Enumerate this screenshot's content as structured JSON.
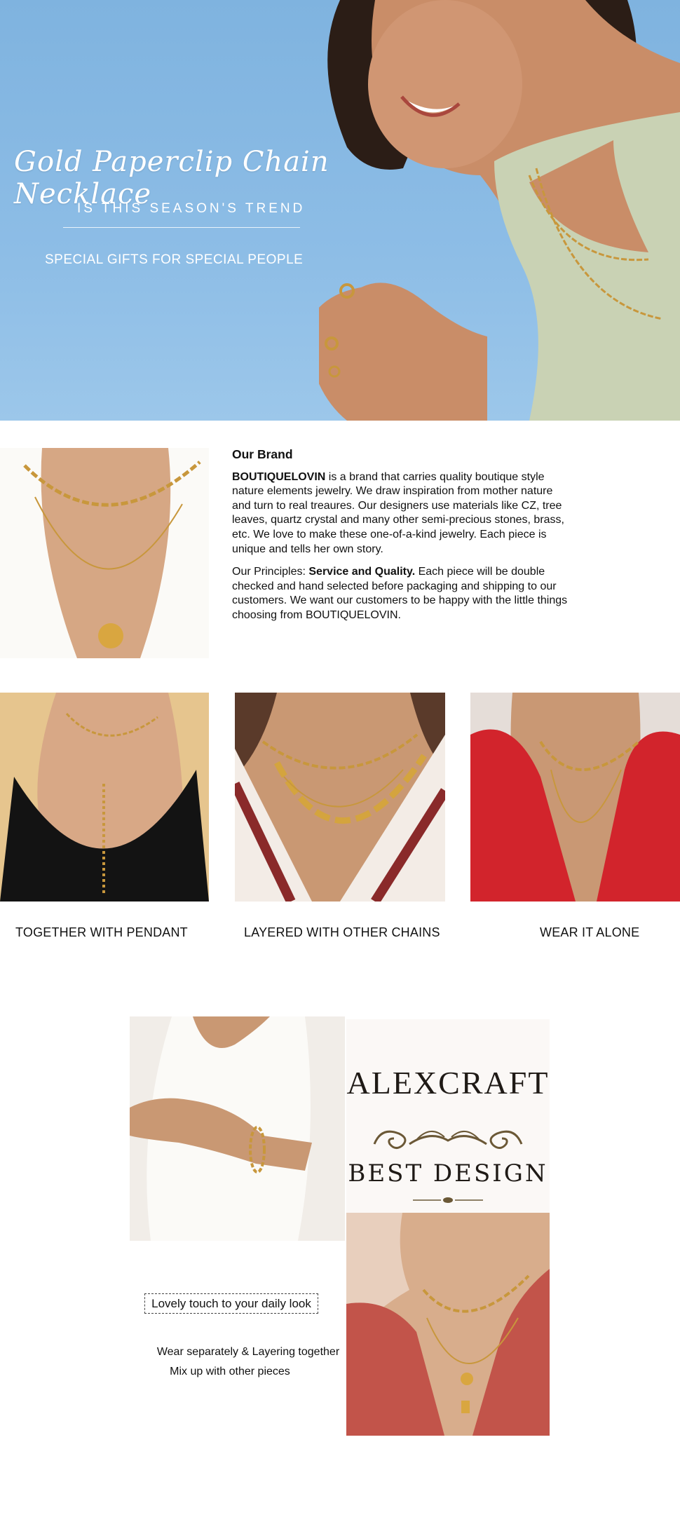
{
  "hero": {
    "title": "Gold Paperclip Chain Necklace",
    "subtitle": "IS THIS SEASON'S TREND",
    "tagline": "SPECIAL GIFTS FOR SPECIAL PEOPLE"
  },
  "brand": {
    "heading": "Our Brand",
    "brand_name": "BOUTIQUELOVIN",
    "paragraph1_rest": " is a brand that carries quality boutique style nature elements jewelry. We draw inspiration from mother nature and turn to real treaures. Our designers use materials like CZ, tree leaves, quartz crystal and many other semi-precious stones, brass, etc. We love to make these one-of-a-kind jewelry. Each piece is unique and tells her own story.",
    "principles_label": "Our Principles: ",
    "principles_bold": "Service and Quality.",
    "principles_rest": " Each piece will be double checked and hand selected before packaging and shipping to our customers. We want our customers to be happy with the little things choosing from BOUTIQUELOVIN."
  },
  "styles": {
    "captions": [
      "TOGETHER WITH PENDANT",
      "LAYERED WITH OTHER CHAINS",
      "WEAR IT ALONE"
    ]
  },
  "promo": {
    "logo_name": "ALEXCRAFT",
    "logo_tagline": "BEST DESIGN",
    "lovely": "Lovely touch to your daily look",
    "wear_line1": "Wear separately &  Layering together",
    "wear_line2": "Mix up with other pieces"
  },
  "colors": {
    "sky": "#8dbde6",
    "gold": "#c8973c",
    "red_top": "#c8262b",
    "rust_top": "#c2544a"
  }
}
